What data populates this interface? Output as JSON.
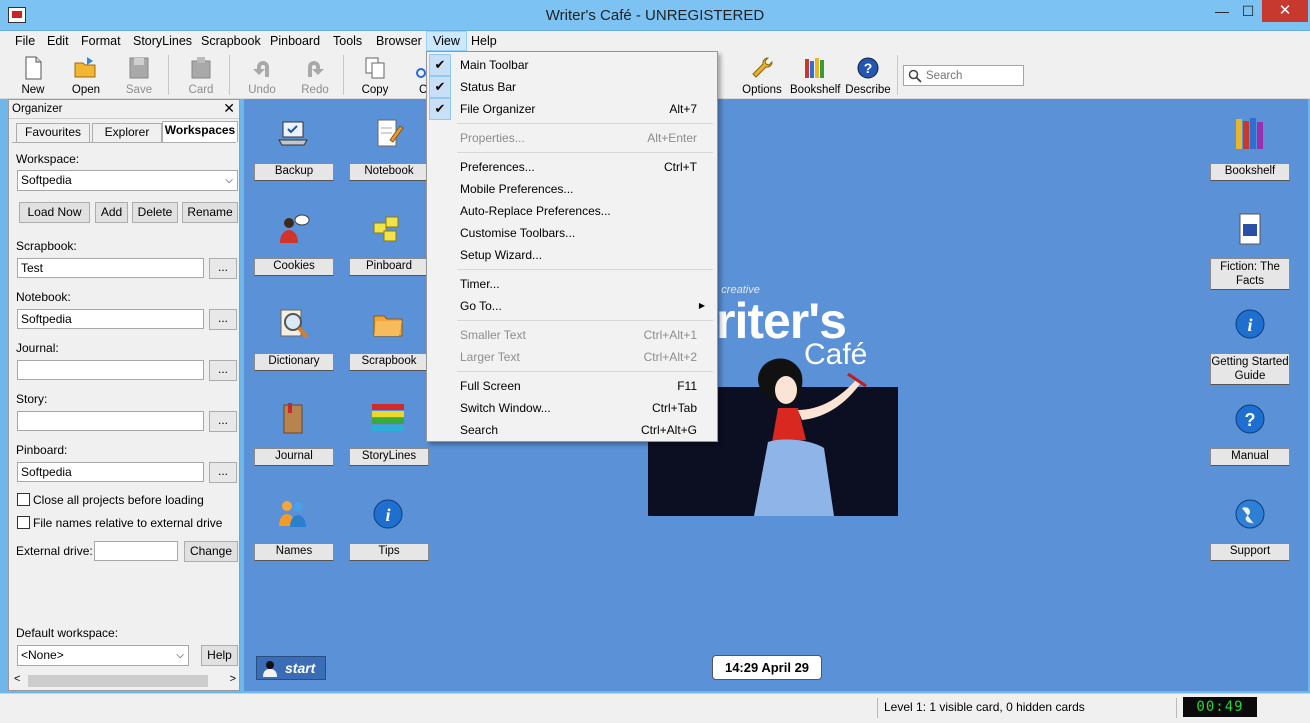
{
  "window": {
    "title": "Writer's Café - UNREGISTERED",
    "minimize": "—",
    "maximize": "☐",
    "close": "✕"
  },
  "menubar": [
    "File",
    "Edit",
    "Format",
    "StoryLines",
    "Scrapbook",
    "Pinboard",
    "Tools",
    "Browser",
    "View",
    "Help"
  ],
  "toolbar": {
    "new": "New",
    "open": "Open",
    "save": "Save",
    "card": "Card",
    "undo": "Undo",
    "redo": "Redo",
    "copy": "Copy",
    "cut_partial": "C",
    "script_partial": "pt",
    "options": "Options",
    "bookshelf": "Bookshelf",
    "describe": "Describe",
    "search_placeholder": "Search"
  },
  "organizer": {
    "title": "Organizer",
    "close": "✕",
    "tabs": [
      "Favourites",
      "Explorer",
      "Workspaces"
    ],
    "workspace_label": "Workspace:",
    "workspace_value": "Softpedia",
    "buttons": {
      "load_now": "Load Now",
      "add": "Add",
      "delete": "Delete",
      "rename": "Rename"
    },
    "scrapbook_label": "Scrapbook:",
    "scrapbook_value": "Test",
    "notebook_label": "Notebook:",
    "notebook_value": "Softpedia",
    "journal_label": "Journal:",
    "journal_value": "",
    "story_label": "Story:",
    "story_value": "",
    "pinboard_label": "Pinboard:",
    "pinboard_value": "Softpedia",
    "browse": "...",
    "close_all_label": "Close all projects before loading",
    "relative_label": "File names relative to external drive",
    "external_drive_label": "External drive:",
    "external_drive_value": "",
    "change": "Change",
    "default_workspace_label": "Default workspace:",
    "default_workspace_value": "<None>",
    "help": "Help"
  },
  "workspace_tiles": {
    "backup": "Backup",
    "notebook": "Notebook",
    "cookies": "Cookies",
    "pinboard": "Pinboard",
    "dictionary": "Dictionary",
    "scrapbook": "Scrapbook",
    "journal": "Journal",
    "storylines": "StoryLines",
    "names": "Names",
    "tips": "Tips",
    "bookshelf": "Bookshelf",
    "fiction_line1": "Fiction: The",
    "fiction_line2": "Facts",
    "getting_line1": "Getting Started",
    "getting_line2": "Guide",
    "manual": "Manual",
    "support": "Support"
  },
  "logo": {
    "tagline": "be creative",
    "title1": "riter's",
    "title2": "Café"
  },
  "start_label": "start",
  "clock": "14:29 April 29",
  "status": {
    "text": "Level 1: 1 visible card, 0 hidden cards",
    "lcd": "00:49"
  },
  "view_menu": {
    "main_toolbar": "Main Toolbar",
    "status_bar": "Status Bar",
    "file_organizer": "File Organizer",
    "file_organizer_sc": "Alt+7",
    "properties": "Properties...",
    "properties_sc": "Alt+Enter",
    "preferences": "Preferences...",
    "preferences_sc": "Ctrl+T",
    "mobile": "Mobile Preferences...",
    "autoreplace": "Auto-Replace Preferences...",
    "customise": "Customise Toolbars...",
    "setup": "Setup Wizard...",
    "timer": "Timer...",
    "goto": "Go To...",
    "smaller": "Smaller Text",
    "smaller_sc": "Ctrl+Alt+1",
    "larger": "Larger Text",
    "larger_sc": "Ctrl+Alt+2",
    "fullscreen": "Full Screen",
    "fullscreen_sc": "F11",
    "switch": "Switch Window...",
    "switch_sc": "Ctrl+Tab",
    "search": "Search",
    "search_sc": "Ctrl+Alt+G"
  },
  "colors": {
    "workspace_bg": "#5b91d6",
    "titlebar": "#7cc3f3",
    "close_button": "#c7392f"
  }
}
